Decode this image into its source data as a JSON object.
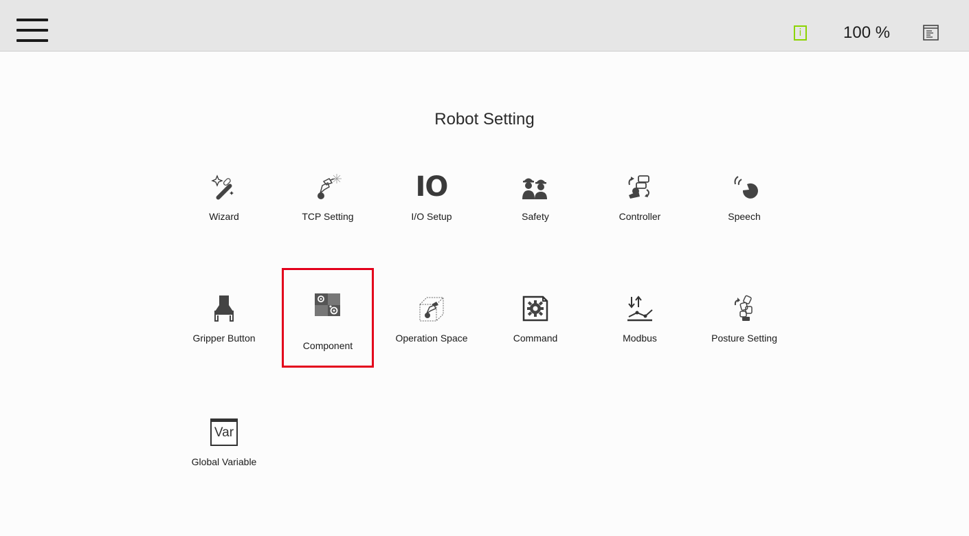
{
  "header": {
    "menu_icon": "hamburger-menu-icon",
    "info_icon": "info-icon",
    "info_glyph": "i",
    "zoom": "100 %",
    "log_icon": "log-panel-icon",
    "info_color": "#8cd400"
  },
  "page": {
    "title": "Robot Setting"
  },
  "tiles": [
    {
      "label": "Wizard",
      "icon": "magic-wand-icon"
    },
    {
      "label": "TCP Setting",
      "icon": "tcp-tool-icon"
    },
    {
      "label": "I/O Setup",
      "icon": "io-icon",
      "glyph": "IO"
    },
    {
      "label": "Safety",
      "icon": "safety-workers-icon"
    },
    {
      "label": "Controller",
      "icon": "controller-robot-icon"
    },
    {
      "label": "Speech",
      "icon": "speech-icon"
    },
    {
      "label": "Gripper Button",
      "icon": "gripper-icon"
    },
    {
      "label": "Component",
      "icon": "component-gears-icon",
      "highlighted": true
    },
    {
      "label": "Operation Space",
      "icon": "operation-space-cube-icon"
    },
    {
      "label": "Command",
      "icon": "command-gear-document-icon"
    },
    {
      "label": "Modbus",
      "icon": "modbus-arrows-chart-icon"
    },
    {
      "label": "Posture Setting",
      "icon": "posture-robot-arm-icon"
    },
    {
      "label": "Global Variable",
      "icon": "global-variable-window-icon",
      "glyph": "Var"
    }
  ],
  "highlight_color": "#e3001b"
}
